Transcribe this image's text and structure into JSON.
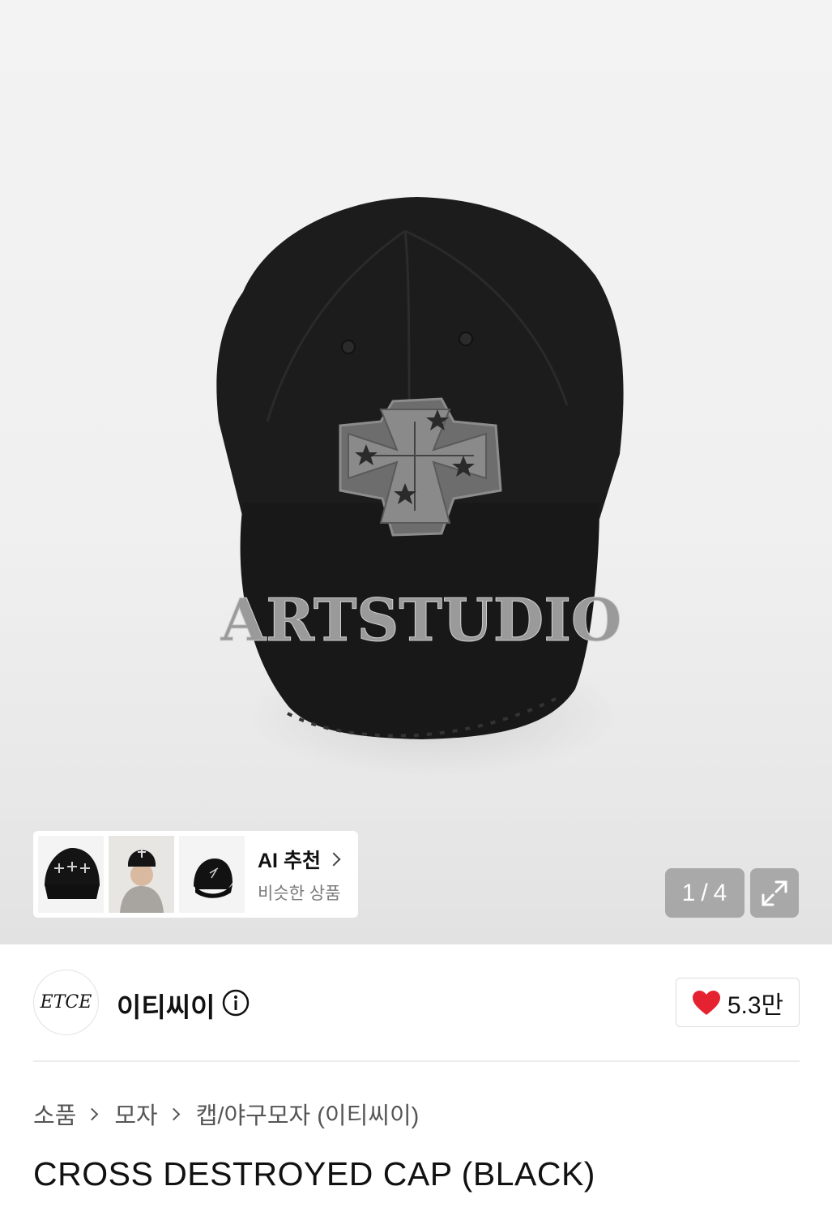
{
  "gallery": {
    "cap_text": "ARTSTUDIO",
    "current_index": "1",
    "separator": "/",
    "total": "4"
  },
  "thumbnails": [
    {
      "name": "thumb-cap-front"
    },
    {
      "name": "thumb-model"
    },
    {
      "name": "thumb-cap-side"
    }
  ],
  "ai_recommend": {
    "title": "AI 추천",
    "subtitle": "비슷한 상품"
  },
  "brand": {
    "logo_text": "ETCE",
    "name": "이티씨이",
    "likes": "5.3만",
    "like_color": "#e5222f"
  },
  "breadcrumb": [
    "소품",
    "모자",
    "캡/야구모자 (이티씨이)"
  ],
  "product": {
    "title": "CROSS DESTROYED CAP (BLACK)"
  },
  "icons": [
    "info-icon",
    "heart-icon",
    "expand-icon",
    "chevron-right-icon"
  ]
}
